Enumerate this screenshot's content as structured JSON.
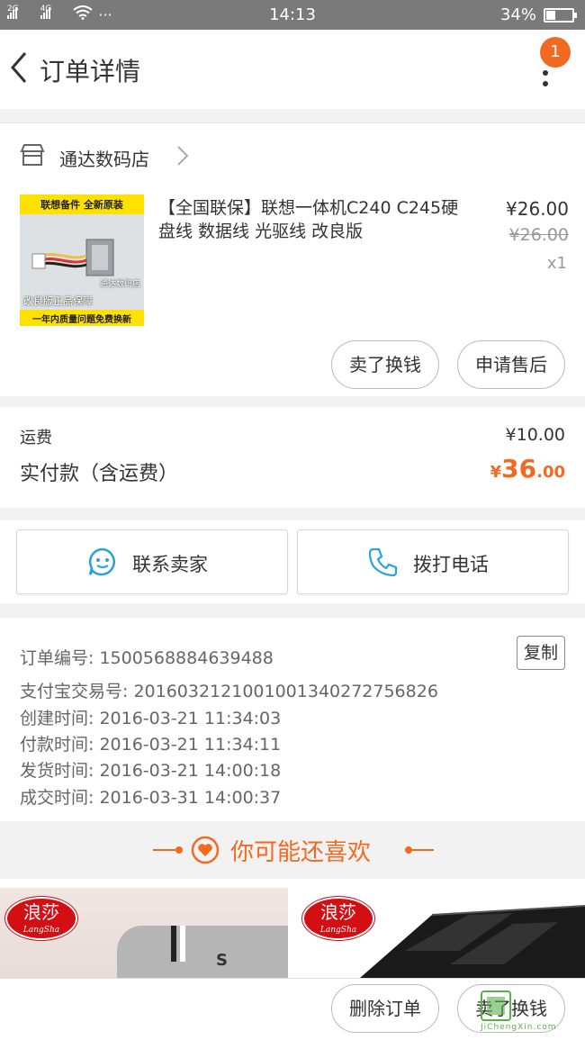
{
  "status_bar": {
    "signal1": "2G",
    "signal2": "4G",
    "dots": "···",
    "time": "14:13",
    "battery_text": "34%",
    "battery_level": 0.34
  },
  "nav": {
    "title": "订单详情",
    "badge_count": "1"
  },
  "store": {
    "name": "通达数码店"
  },
  "product": {
    "title": "【全国联保】联想一体机C240 C245硬盘线 数据线 光驱线 改良版",
    "price": "¥26.00",
    "original_price": "¥26.00",
    "quantity": "x1",
    "thumb_top_text": "联想备件  全新原装",
    "thumb_store_text": "通达数码店",
    "thumb_guarantee_text": "改良版正品保障",
    "thumb_bottom_text": "一年内质量问题免费换新",
    "sell_button": "卖了换钱",
    "after_sale_button": "申请售后"
  },
  "totals": {
    "shipping_label": "运费",
    "shipping_value": "¥10.00",
    "paid_label": "实付款（含运费）",
    "paid_symbol": "¥",
    "paid_integer": "36",
    "paid_decimal": ".00"
  },
  "actions": {
    "contact_seller": "联系卖家",
    "call_phone": "拨打电话"
  },
  "order_info": {
    "order_number": "订单编号: 1500568884639488",
    "alipay_number": "支付宝交易号: 2016032121001001340272756826",
    "created": "创建时间: 2016-03-21 11:34:03",
    "paid": "付款时间: 2016-03-21 11:34:11",
    "shipped": "发货时间: 2016-03-21 14:00:18",
    "completed": "成交时间: 2016-03-31 14:00:37",
    "copy_button": "复制"
  },
  "recommend": {
    "title": "你可能还喜欢",
    "brand": "浪莎",
    "brand_latin": "LangSha",
    "sock_text": "S"
  },
  "bottom_bar": {
    "delete_button": "删除订单",
    "sell_button": "卖了换钱"
  },
  "watermark": {
    "text": "JiChengXin.com"
  },
  "colors": {
    "accent": "#f26a22",
    "status_bar": "#7a7a7a",
    "icon_blue": "#2aa3dc"
  }
}
